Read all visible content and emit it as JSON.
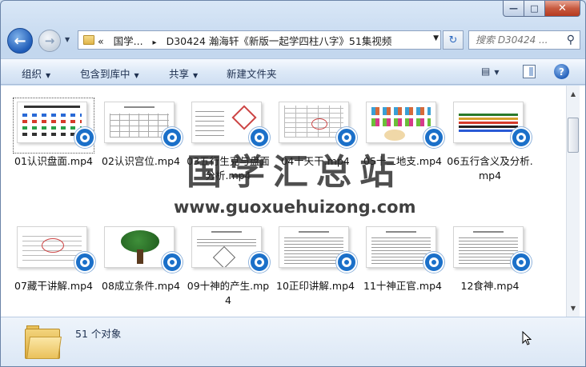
{
  "window": {
    "minimize_glyph": "—",
    "maximize_glyph": "□",
    "close_glyph": "✕"
  },
  "nav": {
    "back_glyph": "←",
    "forward_glyph": "→",
    "address_overflow": "«",
    "address_parts": [
      "国学...",
      "D30424 瀚海轩《新版一起学四柱八字》51集视频"
    ],
    "address_sep": "▸",
    "search_placeholder": "搜索 D30424 ...",
    "refresh_glyph": "↻"
  },
  "toolbar": {
    "organize": "组织",
    "include_library": "包含到库中",
    "share": "共享",
    "new_folder": "新建文件夹"
  },
  "files": [
    {
      "name": "01认识盘面.mp4",
      "selected": true
    },
    {
      "name": "02认识宫位.mp4"
    },
    {
      "name": "03五行生克与盘面分析.mp4"
    },
    {
      "name": "04十天干.mp4"
    },
    {
      "name": "05十二地支.mp4"
    },
    {
      "name": "06五行含义及分析.mp4"
    },
    {
      "name": "07藏干讲解.mp4"
    },
    {
      "name": "08成立条件.mp4"
    },
    {
      "name": "09十神的产生.mp4"
    },
    {
      "name": "10正印讲解.mp4"
    },
    {
      "name": "11十神正官.mp4"
    },
    {
      "name": "12食神.mp4"
    }
  ],
  "details": {
    "count_text": "51 个对象"
  },
  "watermark": {
    "title": "国学汇总站",
    "url": "www.guoxuehuizong.com"
  },
  "colors": {
    "badge": "#1b70c9",
    "close_button": "#c75a40",
    "toolbar_bg": "#dde9f7"
  }
}
